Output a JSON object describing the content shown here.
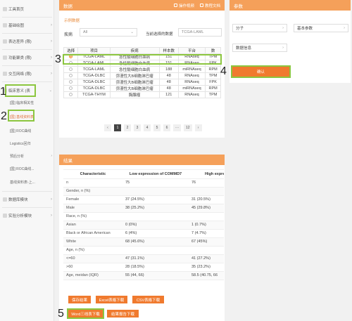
{
  "sidebar": {
    "items": [
      {
        "label": "工具首页"
      },
      {
        "label": "基础绘图"
      },
      {
        "label": "表达差异 (限)"
      },
      {
        "label": "功能聚类 (限)"
      },
      {
        "label": "交互网络 (限)"
      },
      {
        "label": "临床意义 (表"
      }
    ],
    "subitems": [
      "[国] 临床相关性",
      "[国] 基线资料表",
      "[国] ROC曲线",
      "Logistics回归",
      "预后分析",
      "[国] ROC曲线...",
      "基线资料表-上..."
    ],
    "bottom_items": [
      {
        "label": "数据库模块"
      },
      {
        "label": "实验分析模块"
      }
    ]
  },
  "data_panel": {
    "title": "数据",
    "actions": [
      "操作视频",
      "教程文档"
    ],
    "link": "示例数据",
    "filter_label": "疾病",
    "filter_value": "All",
    "selected_label": "当前选择的数据",
    "selected_value": "TCGA-LAML",
    "columns": [
      "选择",
      "项目",
      "疾病",
      "样本数",
      "平台",
      "数"
    ],
    "rows": [
      [
        "TCGA-LAML",
        "急性髓细胞白血病",
        "151",
        "RNAseq",
        "TPM"
      ],
      [
        "TCGA-LAML",
        "急性髓细胞白血病",
        "151",
        "RNAseq",
        "FPK"
      ],
      [
        "TCGA-LAML",
        "急性髓细胞白血病",
        "188",
        "miRNAseq",
        "RPM"
      ],
      [
        "TCGA-DLBC",
        "弥漫性大B细胞淋巴瘤",
        "48",
        "RNAseq",
        "TPM"
      ],
      [
        "TCGA-DLBC",
        "弥漫性大B细胞淋巴瘤",
        "48",
        "RNAseq",
        "FPK"
      ],
      [
        "TCGA-DLBC",
        "弥漫性大B细胞淋巴瘤",
        "48",
        "miRNAseq",
        "RPM"
      ],
      [
        "TCGA-THYM",
        "胸腺瘤",
        "121",
        "RNAseq",
        "TPM"
      ]
    ],
    "pages": [
      "‹",
      "1",
      "2",
      "3",
      "4",
      "5",
      "6",
      "···",
      "12",
      "›"
    ]
  },
  "params_panel": {
    "title": "参数",
    "molecule_label": "分子",
    "basic_label": "基本参数",
    "data_info_label": "数据信息",
    "confirm_label": "确认"
  },
  "result_panel": {
    "title": "结果",
    "columns": [
      "Characteristic",
      "Low expression of COMMD7",
      "High expressi"
    ],
    "rows": [
      [
        "n",
        "75",
        "76"
      ],
      [
        "Gender, n (%)",
        "",
        ""
      ],
      [
        "Female",
        "37 (24.5%)",
        "31 (20.5%)"
      ],
      [
        "Male",
        "38 (25.2%)",
        "45 (29.8%)"
      ],
      [
        "Race, n (%)",
        "",
        ""
      ],
      [
        "Asian",
        "0 (0%)",
        "1 (0.7%)"
      ],
      [
        "Black or African American",
        "6 (4%)",
        "7 (4.7%)"
      ],
      [
        "White",
        "68 (45.6%)",
        "67 (45%)"
      ],
      [
        "Age, n (%)",
        "",
        ""
      ],
      [
        "<=60",
        "47 (31.1%)",
        "41 (27.2%)"
      ],
      [
        ">60",
        "28 (18.5%)",
        "35 (23.2%)"
      ],
      [
        "Age, meidan (IQR)",
        "55 (44, 66)",
        "58.5 (40.75, 66"
      ]
    ],
    "buttons_row1": [
      "保存结果",
      "Excel表格下载",
      "CSV表格下载"
    ],
    "buttons_row2": [
      "Word三线表下载",
      "结果报告下载"
    ]
  },
  "annotations": [
    "1",
    "2",
    "3",
    "4",
    "5"
  ]
}
